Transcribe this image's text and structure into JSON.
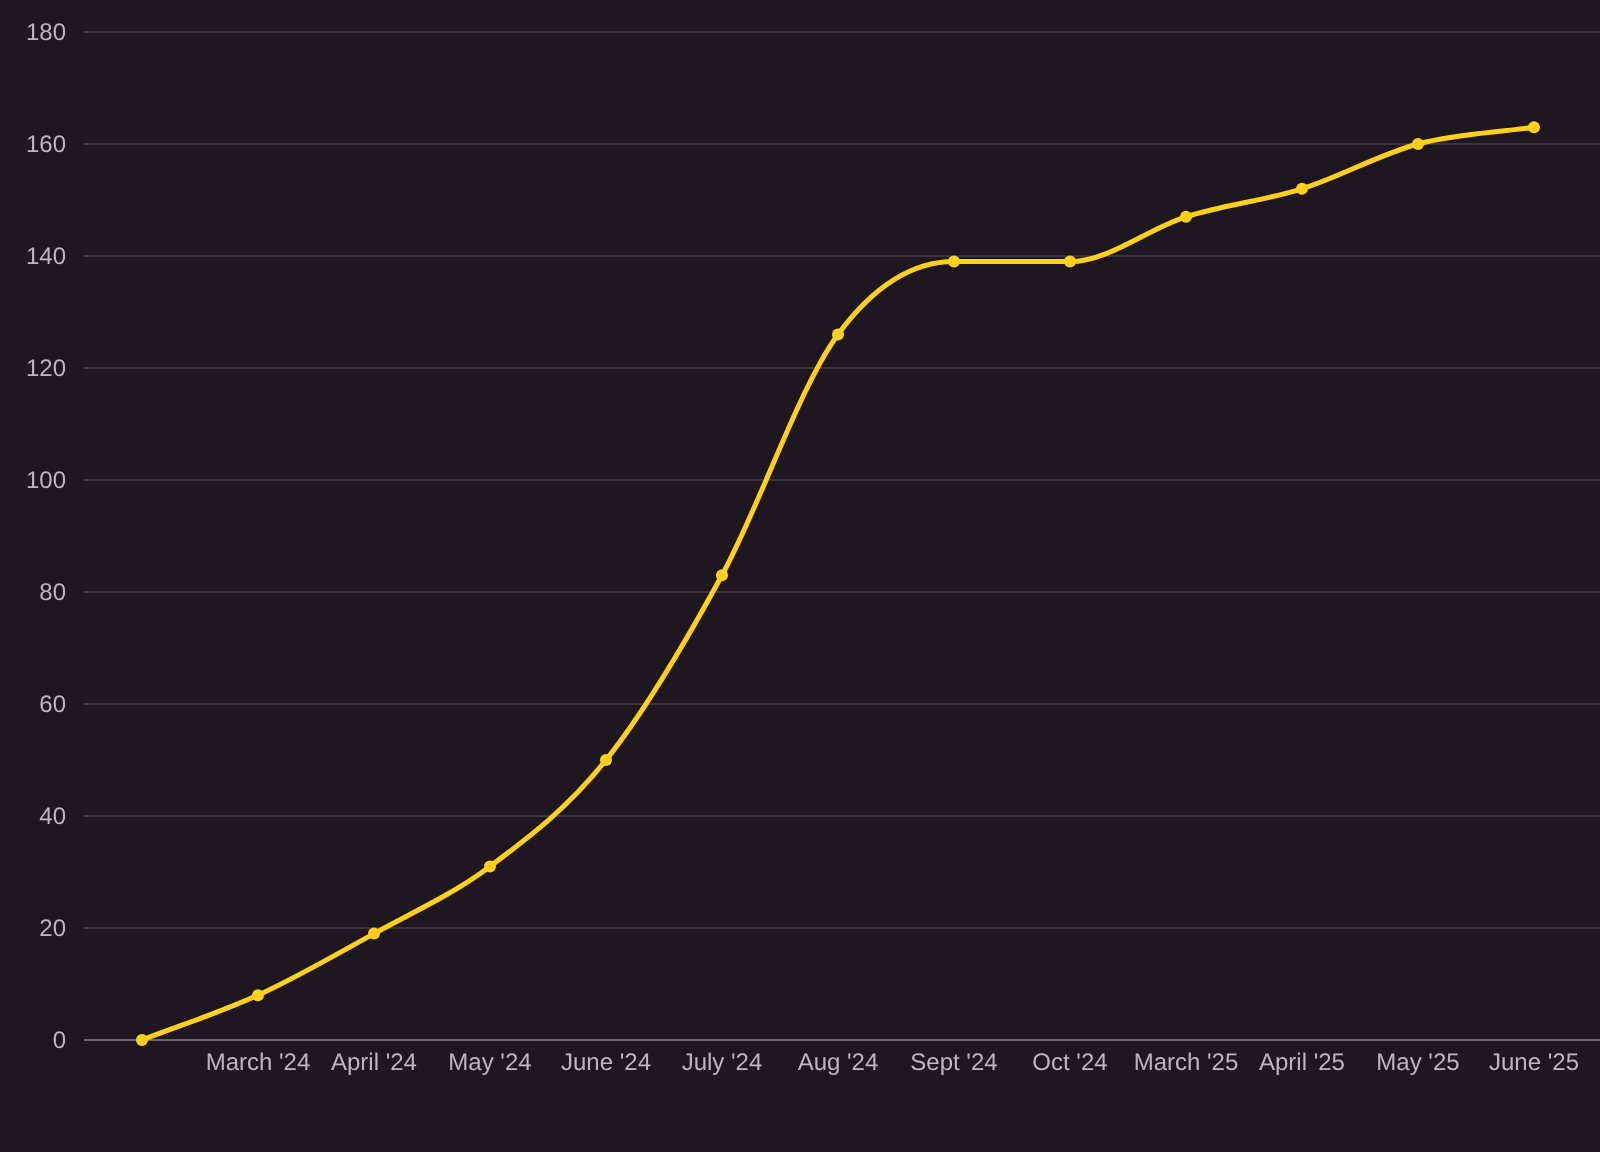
{
  "chart_data": {
    "type": "line",
    "categories": [
      null,
      "March '24",
      "April '24",
      "May '24",
      "June '24",
      "July '24",
      "Aug '24",
      "Sept '24",
      "Oct '24",
      "March '25",
      "April '25",
      "May '25",
      "June '25"
    ],
    "grid": true,
    "series": [
      {
        "color": "#ffd11a",
        "marker": true,
        "values": [
          0,
          8,
          19,
          31,
          50,
          83,
          126,
          139,
          139,
          147,
          152,
          160,
          163
        ]
      }
    ],
    "ylim": [
      0,
      180
    ],
    "yticks": [
      0,
      20,
      40,
      60,
      80,
      100,
      120,
      140,
      160,
      180
    ]
  }
}
